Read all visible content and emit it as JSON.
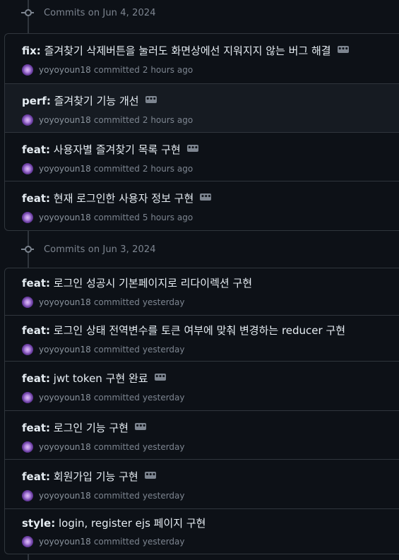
{
  "groups": [
    {
      "title": "Commits on Jun 4, 2024",
      "commits": [
        {
          "prefix": "fix:",
          "title": "즐겨찾기 삭제버튼을 눌러도 화면상에선 지워지지 않는 버그 해결",
          "author": "yoyoyoun18",
          "action": "committed",
          "time": "2 hours ago"
        },
        {
          "prefix": "perf:",
          "title": "즐겨찾기 기능 개선",
          "author": "yoyoyoun18",
          "action": "committed",
          "time": "2 hours ago"
        },
        {
          "prefix": "feat:",
          "title": "사용자별 즐겨찾기 목록 구현",
          "author": "yoyoyoun18",
          "action": "committed",
          "time": "2 hours ago"
        },
        {
          "prefix": "feat:",
          "title": "현재 로그인한 사용자 정보 구현",
          "author": "yoyoyoun18",
          "action": "committed",
          "time": "5 hours ago"
        }
      ]
    },
    {
      "title": "Commits on Jun 3, 2024",
      "commits": [
        {
          "prefix": "feat:",
          "title": "로그인 성공시 기본페이지로 리다이렉션 구현",
          "author": "yoyoyoun18",
          "action": "committed",
          "time": "yesterday"
        },
        {
          "prefix": "feat:",
          "title": "로그인 상태 전역변수를 토큰 여부에 맞춰 변경하는 reducer 구현",
          "author": "yoyoyoun18",
          "action": "committed",
          "time": "yesterday"
        },
        {
          "prefix": "feat:",
          "title": "jwt token 구현 완료",
          "author": "yoyoyoun18",
          "action": "committed",
          "time": "yesterday"
        },
        {
          "prefix": "feat:",
          "title": "로그인 기능 구현",
          "author": "yoyoyoun18",
          "action": "committed",
          "time": "yesterday"
        },
        {
          "prefix": "feat:",
          "title": "회원가입 기능 구현",
          "author": "yoyoyoun18",
          "action": "committed",
          "time": "yesterday"
        },
        {
          "prefix": "style:",
          "title": "login, register ejs 페이지 구현",
          "author": "yoyoyoun18",
          "action": "committed",
          "time": "yesterday"
        }
      ]
    }
  ],
  "ellipsis_label": "•••",
  "colors": {
    "background": "#0d1117",
    "border": "#30363d",
    "muted": "#7d8590",
    "text": "#e6edf3",
    "hover_row": "#161b22"
  }
}
